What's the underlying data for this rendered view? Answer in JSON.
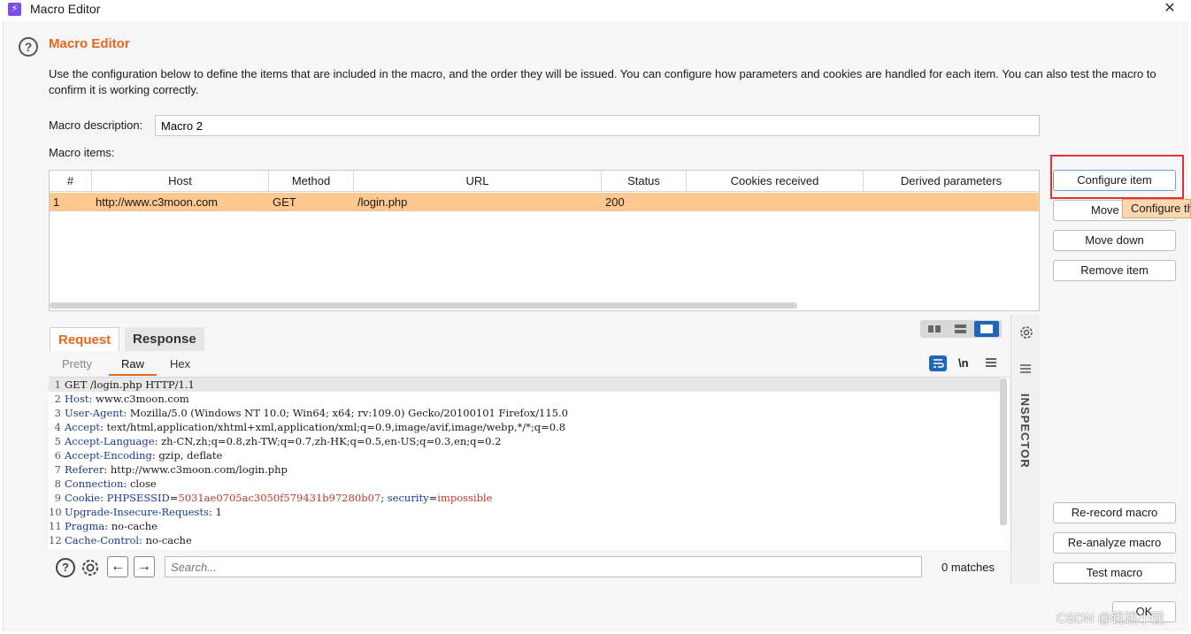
{
  "window": {
    "title": "Macro Editor",
    "close_glyph": "✕",
    "app_icon_glyph": "⚡"
  },
  "heading": "Macro Editor",
  "description": "Use the configuration below to define the items that are included in the macro, and the order they will be issued. You can configure how parameters and cookies are handled for each item. You can also test the macro to confirm it is working correctly.",
  "macro_description_label": "Macro description:",
  "macro_description_value": "Macro 2",
  "macro_items_label": "Macro items:",
  "table": {
    "headers": [
      "#",
      "Host",
      "Method",
      "URL",
      "Status",
      "Cookies received",
      "Derived parameters"
    ],
    "rows": [
      {
        "num": "1",
        "host": "http://www.c3moon.com",
        "method": "GET",
        "url": "/login.php",
        "status": "200",
        "cookies": "",
        "derived": ""
      }
    ]
  },
  "side_buttons": {
    "configure": "Configure item",
    "move_up": "Move up",
    "move_down": "Move down",
    "remove": "Remove item",
    "re_record": "Re-record macro",
    "re_analyze": "Re-analyze macro",
    "test": "Test macro",
    "ok": "OK"
  },
  "tooltip": "Configure the selected item",
  "tabs": {
    "request": "Request",
    "response": "Response"
  },
  "subtabs": {
    "pretty": "Pretty",
    "raw": "Raw",
    "hex": "Hex"
  },
  "newline_toggle": "\\n",
  "request_lines": [
    {
      "n": "1",
      "name": "GET /login.php HTTP/1.1",
      "sep": "",
      "value": ""
    },
    {
      "n": "2",
      "name": "Host",
      "sep": ": ",
      "value": "www.c3moon.com"
    },
    {
      "n": "3",
      "name": "User-Agent",
      "sep": ": ",
      "value": "Mozilla/5.0 (Windows NT 10.0; Win64; x64; rv:109.0) Gecko/20100101 Firefox/115.0"
    },
    {
      "n": "4",
      "name": "Accept",
      "sep": ": ",
      "value": "text/html,application/xhtml+xml,application/xml;q=0.9,image/avif,image/webp,*/*;q=0.8"
    },
    {
      "n": "5",
      "name": "Accept-Language",
      "sep": ": ",
      "value": "zh-CN,zh;q=0.8,zh-TW;q=0.7,zh-HK;q=0.5,en-US;q=0.3,en;q=0.2"
    },
    {
      "n": "6",
      "name": "Accept-Encoding",
      "sep": ": ",
      "value": "gzip, deflate"
    },
    {
      "n": "7",
      "name": "Referer",
      "sep": ": ",
      "value": "http://www.c3moon.com/login.php"
    },
    {
      "n": "8",
      "name": "Connection",
      "sep": ": ",
      "value": "close"
    },
    {
      "n": "10",
      "name": "Upgrade-Insecure-Requests",
      "sep": ": ",
      "value": "1"
    },
    {
      "n": "11",
      "name": "Pragma",
      "sep": ": ",
      "value": "no-cache"
    },
    {
      "n": "12",
      "name": "Cache-Control",
      "sep": ": ",
      "value": "no-cache"
    }
  ],
  "cookie_line": {
    "n": "9",
    "name": "Cookie",
    "c1n": "PHPSESSID",
    "c1v": "5031ae0705ac3050f579431b97280b07",
    "c2n": "security",
    "c2v": "impossible"
  },
  "inspector_label": "INSPECTOR",
  "search": {
    "placeholder": "Search...",
    "matches": "0 matches"
  },
  "watermark": "CSDN @跳跳小强",
  "colors": {
    "accent": "#e8661f",
    "selected_row": "#fec890",
    "highlight_box": "#e23131",
    "tooltip_bg": "#fdd7b0"
  }
}
